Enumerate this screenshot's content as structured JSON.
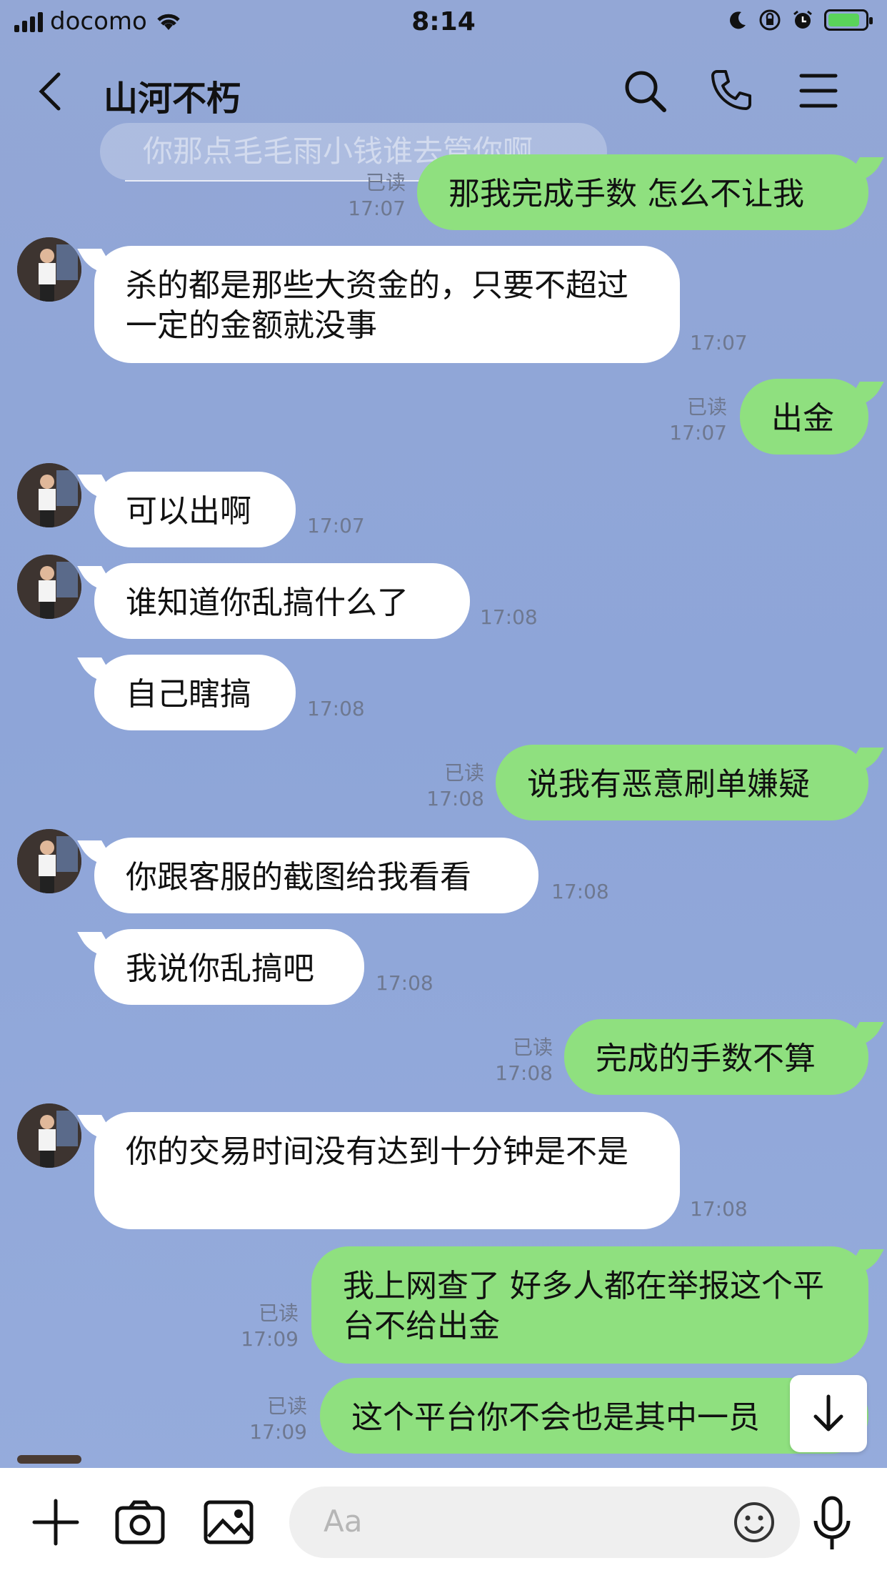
{
  "status_bar": {
    "carrier": "docomo",
    "time": "8:14"
  },
  "header": {
    "title": "山河不朽",
    "ghost_text": "你那点毛毛雨小钱谁去管你啊"
  },
  "messages": [
    {
      "dir": "out",
      "text": "那我完成手数 怎么不让我",
      "read": "已读",
      "time": "17:07"
    },
    {
      "dir": "in",
      "text": "杀的都是那些大资金的，只要不超过一定的金额就没事",
      "time": "17:07"
    },
    {
      "dir": "out",
      "text": "出金",
      "read": "已读",
      "time": "17:07"
    },
    {
      "dir": "in",
      "text": "可以出啊",
      "time": "17:07"
    },
    {
      "dir": "in",
      "text": "谁知道你乱搞什么了",
      "time": "17:08"
    },
    {
      "dir": "in",
      "text": "自己瞎搞",
      "time": "17:08"
    },
    {
      "dir": "out",
      "text": "说我有恶意刷单嫌疑",
      "read": "已读",
      "time": "17:08"
    },
    {
      "dir": "in",
      "text": "你跟客服的截图给我看看",
      "time": "17:08"
    },
    {
      "dir": "in",
      "text": "我说你乱搞吧",
      "time": "17:08"
    },
    {
      "dir": "out",
      "text": "完成的手数不算",
      "read": "已读",
      "time": "17:08"
    },
    {
      "dir": "in",
      "text": "你的交易时间没有达到十分钟是不是",
      "time": "17:08"
    },
    {
      "dir": "out",
      "text": "我上网查了 好多人都在举报这个平台不给出金",
      "read": "已读",
      "time": "17:09"
    },
    {
      "dir": "out",
      "text": "这个平台你不会也是其中一员",
      "read": "已读",
      "time": "17:09"
    }
  ],
  "input": {
    "placeholder": "Aa"
  },
  "icons": {
    "back": "chevron-left-icon",
    "search": "search-icon",
    "call": "phone-icon",
    "menu": "menu-icon",
    "scroll": "arrow-down-icon",
    "plus": "plus-icon",
    "camera": "camera-icon",
    "image": "image-icon",
    "emoji": "emoji-icon",
    "mic": "microphone-icon"
  },
  "colors": {
    "background": "#93a7d6",
    "outgoing_bubble": "#8fe07f",
    "incoming_bubble": "#ffffff"
  }
}
